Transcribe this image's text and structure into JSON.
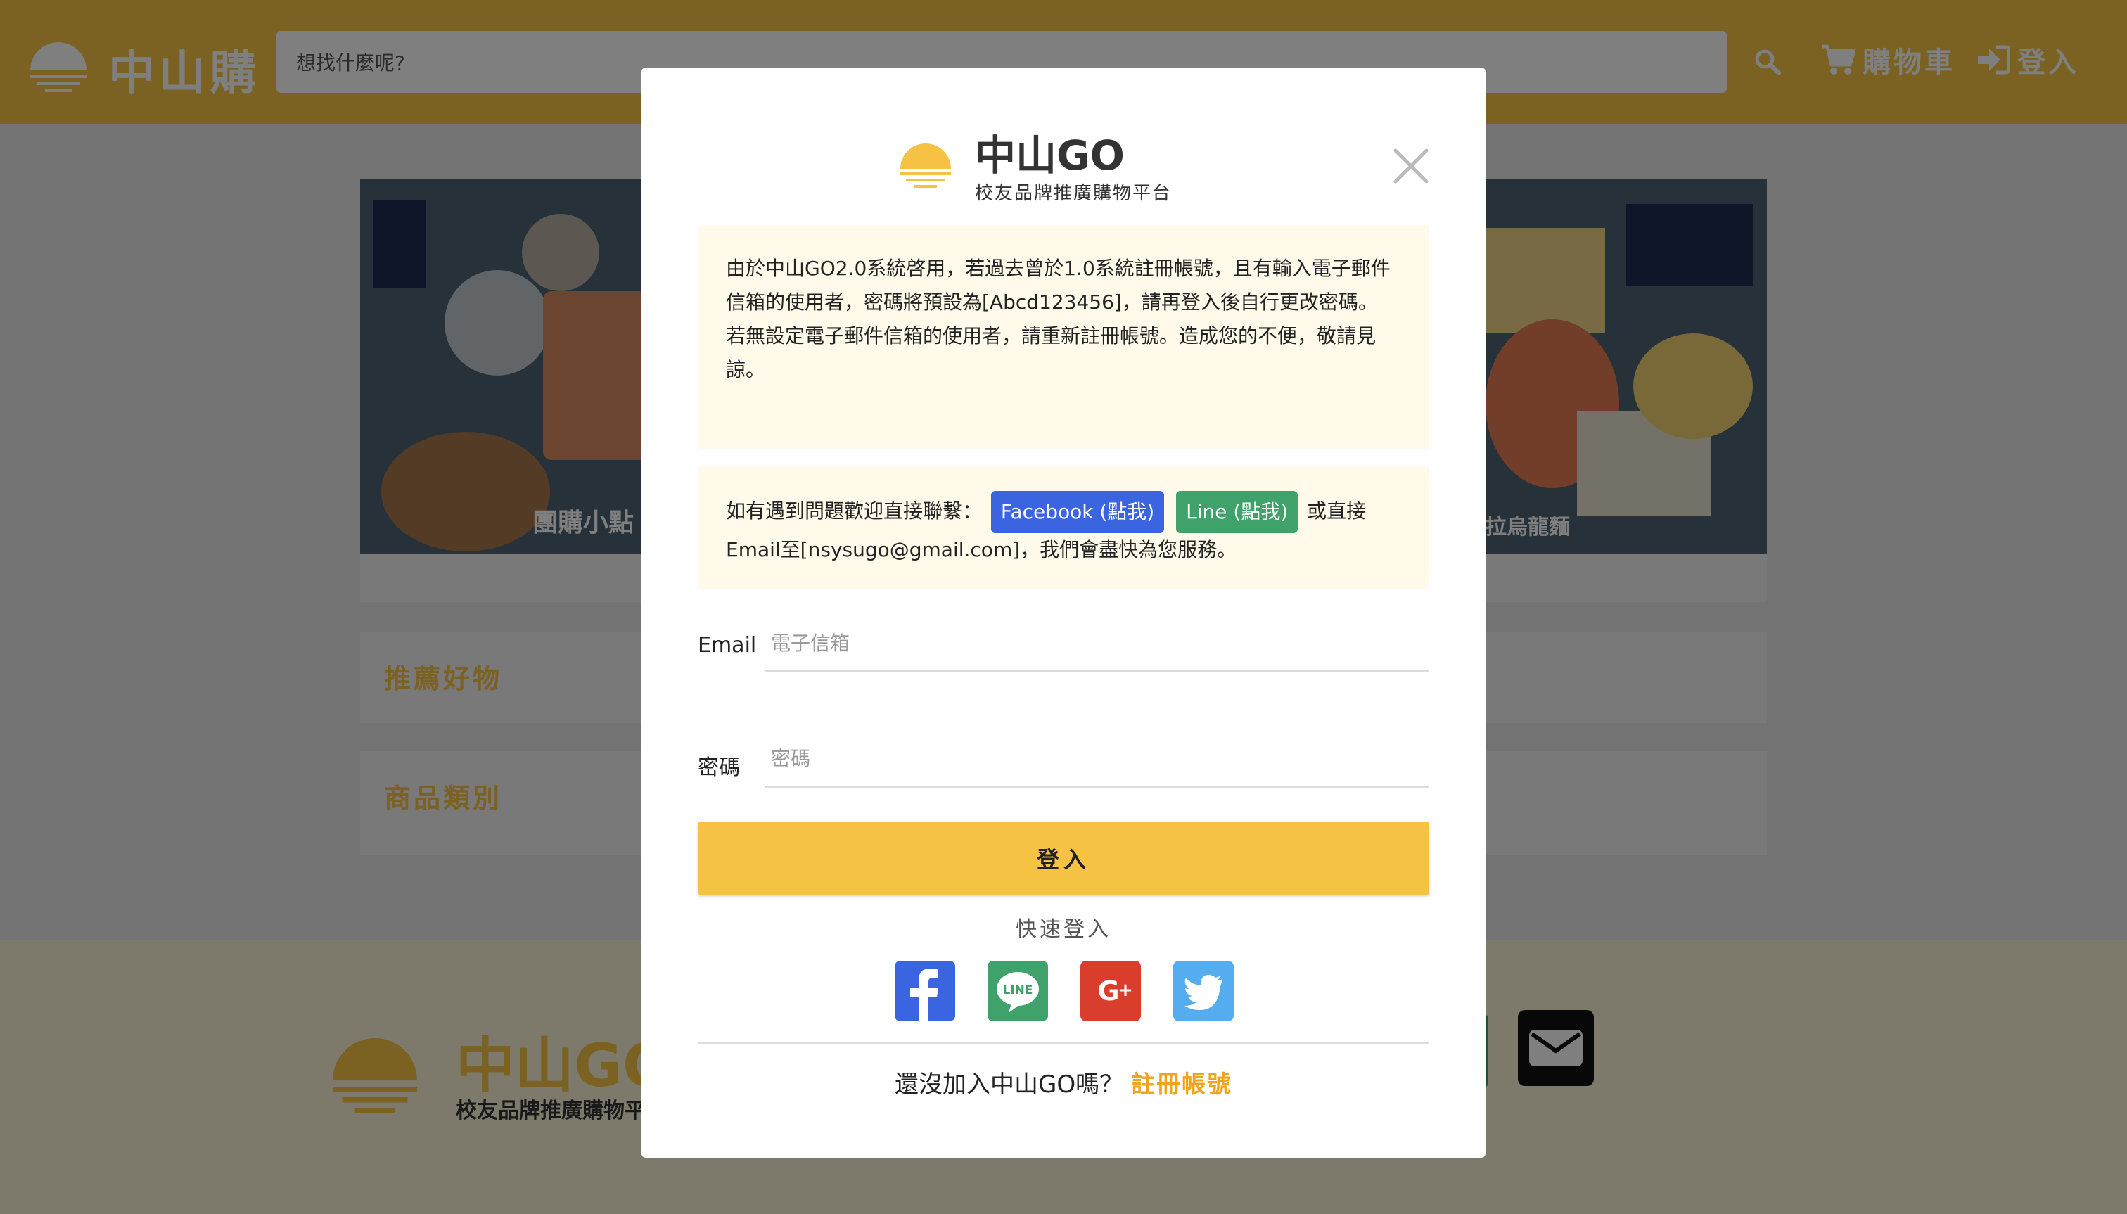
{
  "header": {
    "brand": "中山購",
    "search_placeholder": "想找什麼呢?",
    "cart_label": "購物車",
    "login_label": "登入",
    "accent_color": "#f6c244"
  },
  "page": {
    "banner_left_caption": "團購小點",
    "banner_right_caption": "拉烏龍麵",
    "section_recommended": "推薦好物",
    "section_categories": "商品類別"
  },
  "footer": {
    "brand": "中山GO",
    "sub": "校友品牌推廣購物平台"
  },
  "modal": {
    "brand": "中山GO",
    "sub": "校友品牌推廣購物平台",
    "notice_para1": "由於中山GO2.0系統啓用，若過去曾於1.0系統註冊帳號，且有輸入電子郵件信箱的使用者，密碼將預設為[Abcd123456]，請再登入後自行更改密碼。",
    "notice_para2": "若無設定電子郵件信箱的使用者，請重新註冊帳號。造成您的不便，敬請見諒。",
    "contact_prefix": "如有遇到問題歡迎直接聯繫：",
    "facebook_label": "Facebook (點我)",
    "line_label": "Line (點我)",
    "contact_suffix": "或直接Email至[nsysugo@gmail.com]，我們會盡快為您服務。",
    "email_label": "Email",
    "email_placeholder": "電子信箱",
    "password_label": "密碼",
    "password_placeholder": "密碼",
    "login_button": "登入",
    "quick_login": "快速登入",
    "signup_prompt": "還沒加入中山GO嗎？",
    "signup_link": "註冊帳號"
  },
  "icons": {
    "close": "close-icon",
    "search": "search-icon",
    "cart": "cart-icon",
    "login": "sign-in-icon",
    "facebook": "facebook-icon",
    "line": "line-icon",
    "google_plus": "google-plus-icon",
    "twitter": "twitter-icon",
    "mail": "mail-icon"
  },
  "colors": {
    "facebook": "#3b65e0",
    "line": "#3fa26b",
    "google_plus": "#d93e2d",
    "twitter": "#55acee",
    "signup_link": "#f0a31c"
  }
}
